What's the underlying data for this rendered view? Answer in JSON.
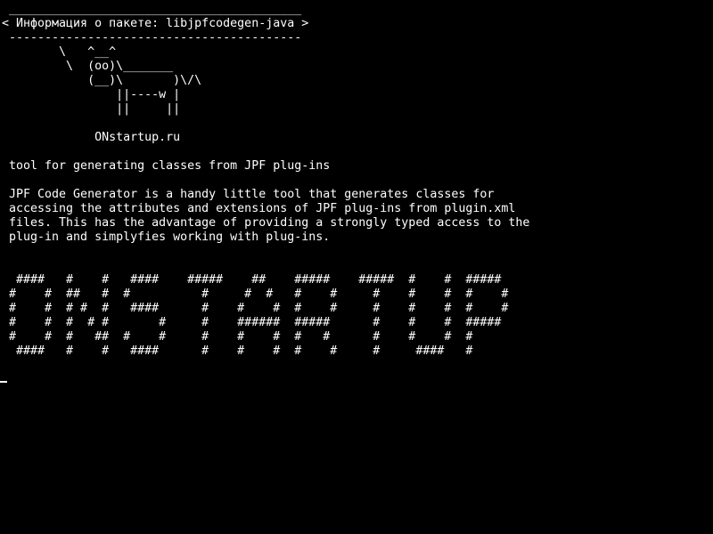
{
  "terminal": {
    "lines": [
      " _________________________________________",
      "< Информация о пакете: libjpfcodegen-java >",
      " -----------------------------------------",
      "        \\   ^__^",
      "         \\  (oo)\\_______",
      "            (__)\\       )\\/\\",
      "                ||----w |",
      "                ||     ||",
      "",
      "             ONstartup.ru",
      "",
      " tool for generating classes from JPF plug-ins",
      "",
      " JPF Code Generator is a handy little tool that generates classes for",
      " accessing the attributes and extensions of JPF plug-ins from plugin.xml",
      " files. This has the advantage of providing a strongly typed access to the",
      " plug-in and simplyfies working with plug-ins.",
      "",
      "",
      "  ####   #    #   ####    #####    ##    #####    #####  #    #  #####",
      " #    #  ##   #  #          #     #  #   #    #     #    #    #  #    #",
      " #    #  # #  #   ####      #    #    #  #    #     #    #    #  #    #",
      " #    #  #  # #       #     #    ######  #####      #    #    #  #####",
      " #    #  #   ##  #    #     #    #    #  #   #      #    #    #  #",
      "  ####   #    #   ####      #    #    #  #    #     #     ####   #"
    ]
  }
}
